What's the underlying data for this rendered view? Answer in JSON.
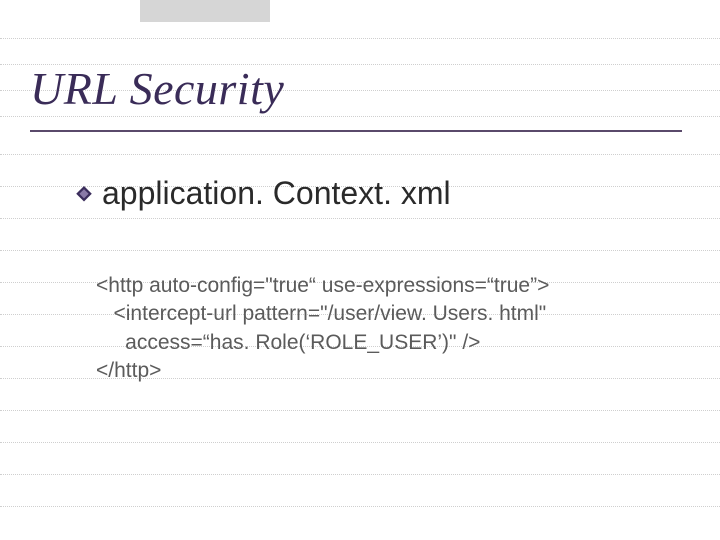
{
  "title": "URL Security",
  "bullet": {
    "icon": "diamond-bullet-icon",
    "text": "application. Context. xml"
  },
  "code": {
    "lines": [
      "<http auto-config=\"true“ use-expressions=“true”>",
      "   <intercept-url pattern=\"/user/view. Users. html\"",
      "     access=“has. Role(‘ROLE_USER’)\" />",
      "</http>"
    ]
  }
}
